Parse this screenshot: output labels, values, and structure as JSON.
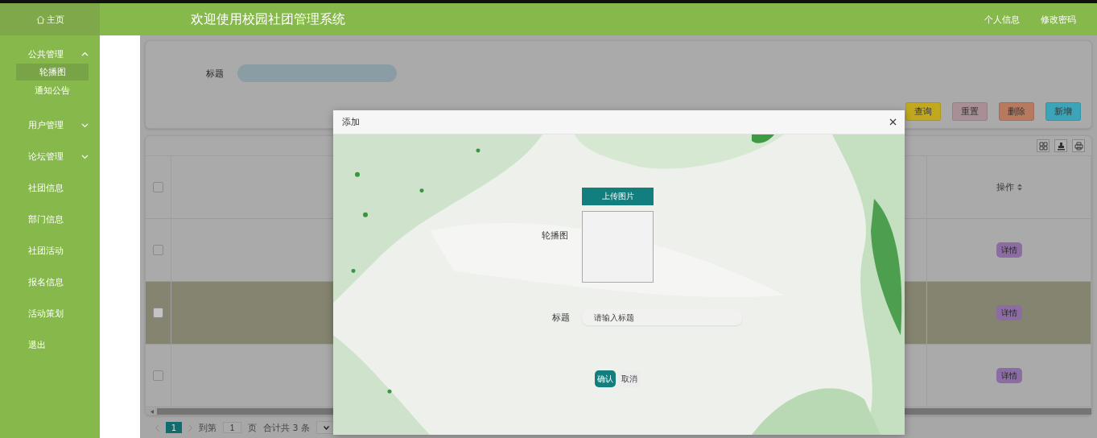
{
  "header": {
    "home": "主页",
    "title": "欢迎使用校园社团管理系统",
    "links": [
      "个人信息",
      "修改密码"
    ]
  },
  "sidebar": {
    "items": [
      {
        "kind": "group",
        "label": "公共管理",
        "expanded": true,
        "selected": false,
        "children": [
          {
            "label": "轮播图",
            "selected": true
          },
          {
            "label": "通知公告",
            "selected": false
          }
        ]
      },
      {
        "kind": "group",
        "label": "用户管理",
        "expanded": false,
        "selected": false
      },
      {
        "kind": "group",
        "label": "论坛管理",
        "expanded": false,
        "selected": false
      },
      {
        "kind": "link",
        "label": "社团信息",
        "selected": false
      },
      {
        "kind": "link",
        "label": "部门信息",
        "selected": false
      },
      {
        "kind": "link",
        "label": "社团活动",
        "selected": false
      },
      {
        "kind": "link",
        "label": "报名信息",
        "selected": false
      },
      {
        "kind": "link",
        "label": "活动策划",
        "selected": false
      },
      {
        "kind": "link",
        "label": "退出",
        "selected": false
      }
    ]
  },
  "search": {
    "label": "标题",
    "buttons": [
      {
        "label": "查询",
        "color": "#c2a81e"
      },
      {
        "label": "重置",
        "color": "#a88f95"
      },
      {
        "label": "删除",
        "color": "#b77a60"
      },
      {
        "label": "新增",
        "color": "#3ba4b9"
      }
    ]
  },
  "table": {
    "header_checked": false,
    "action_header": "操作",
    "rows": [
      {
        "checked": false,
        "selected": false,
        "action": "详情"
      },
      {
        "checked": false,
        "selected": true,
        "action": "详情"
      },
      {
        "checked": false,
        "selected": false,
        "action": "详情"
      }
    ]
  },
  "pagination": {
    "pages": [
      {
        "label": "1",
        "selected": true
      }
    ],
    "jump_label": "到第",
    "jump_value": "1",
    "page_unit": "页",
    "total": "合计共 3 条"
  },
  "modal": {
    "title": "添加",
    "fields": [
      {
        "label": "轮播图",
        "button": "上传图片"
      },
      {
        "kind": "text",
        "label": "标题",
        "placeholder": "请输入标题"
      }
    ],
    "buttons": [
      {
        "kind": "primary",
        "label": "确认"
      },
      {
        "kind": "secondary",
        "label": "取消"
      }
    ]
  }
}
